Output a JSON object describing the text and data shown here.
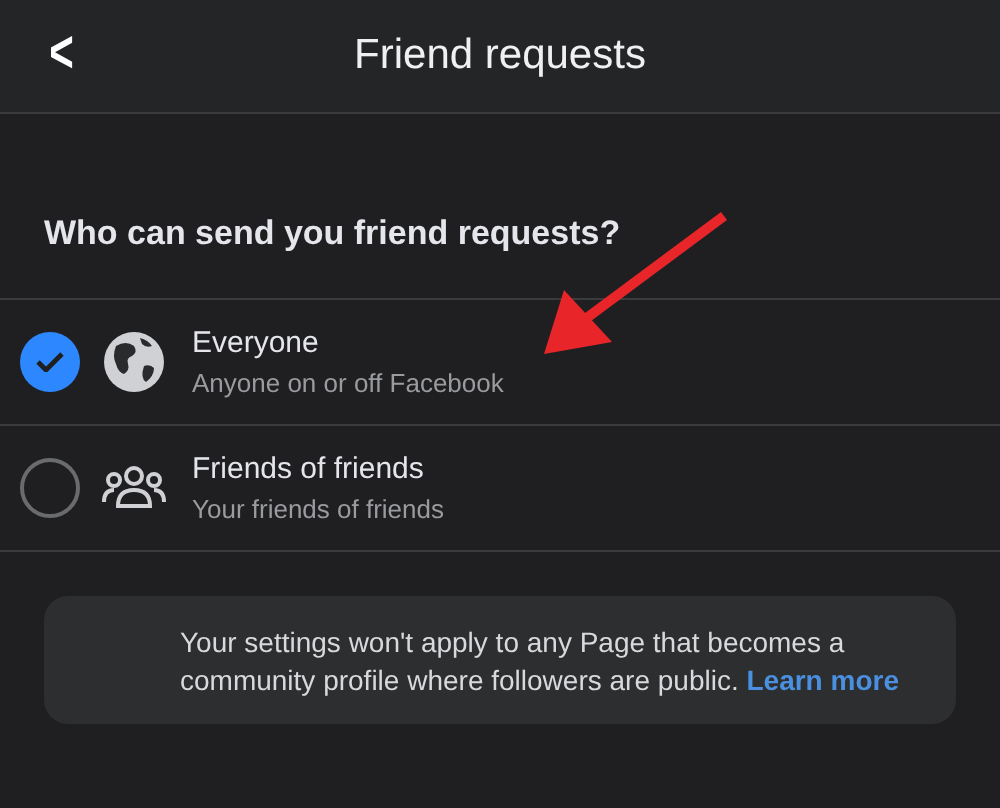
{
  "header": {
    "back": "<",
    "title": "Friend requests"
  },
  "question": "Who can send you friend requests?",
  "options": [
    {
      "kind": "globe",
      "title": "Everyone",
      "subtitle": "Anyone on or off Facebook",
      "selected": true
    },
    {
      "kind": "friends",
      "title": "Friends of friends",
      "subtitle": "Your friends of friends",
      "selected": false
    }
  ],
  "note": {
    "text": "Your settings won't apply to any Page that becomes a community profile where followers are public.",
    "link": "Learn more"
  }
}
